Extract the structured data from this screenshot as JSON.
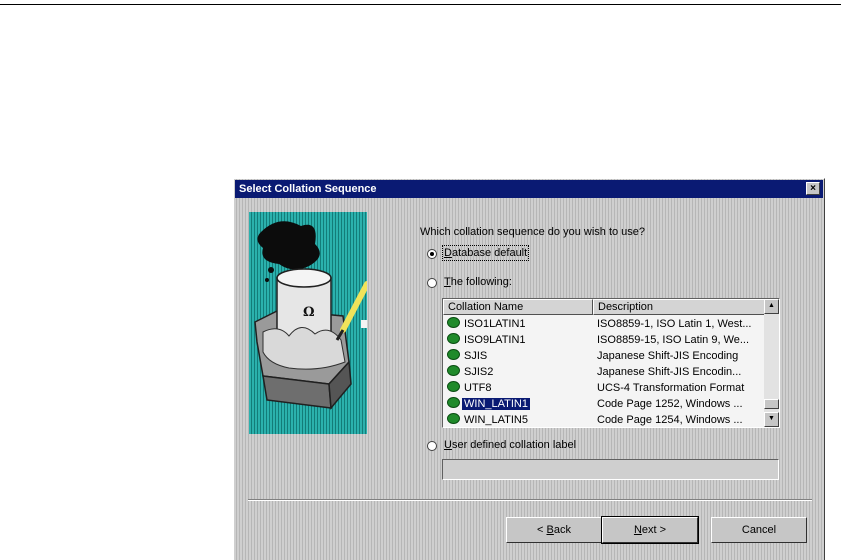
{
  "dialog": {
    "title": "Select Collation Sequence",
    "close_glyph": "×",
    "question": "Which collation sequence do you wish to use?"
  },
  "options": {
    "database_default": {
      "accel": "D",
      "rest": "atabase default",
      "checked": true
    },
    "the_following": {
      "accel": "T",
      "rest": "he following:",
      "checked": false
    },
    "user_defined": {
      "accel": "U",
      "rest": "ser defined collation label",
      "checked": false
    }
  },
  "list": {
    "columns": [
      "Collation Name",
      "Description"
    ],
    "rows": [
      {
        "name": "ISO1LATIN1",
        "description": "ISO8859-1, ISO Latin 1, West..."
      },
      {
        "name": "ISO9LATIN1",
        "description": "ISO8859-15, ISO Latin 9, We..."
      },
      {
        "name": "SJIS",
        "description": "Japanese Shift-JIS Encoding"
      },
      {
        "name": "SJIS2",
        "description": "Japanese Shift-JIS Encodin..."
      },
      {
        "name": "UTF8",
        "description": "UCS-4 Transformation Format"
      },
      {
        "name": "WIN_LATIN1",
        "description": "Code Page 1252, Windows ..."
      },
      {
        "name": "WIN_LATIN5",
        "description": "Code Page 1254, Windows ..."
      }
    ],
    "selected_row": "WIN_LATIN1",
    "scroll_up_glyph": "▲",
    "scroll_down_glyph": "▼"
  },
  "user_label_value": "",
  "buttons": {
    "back": {
      "prefix": "< ",
      "accel": "B",
      "rest": "ack"
    },
    "next": {
      "accel": "N",
      "rest": "ext >"
    },
    "cancel": {
      "label": "Cancel"
    }
  },
  "colors": {
    "titlebar": "#0a1a73",
    "dialog_face": "#c6c6c6",
    "illustration_bg": "#1f9f9c",
    "selection": "#0a1a73",
    "db_icon": "#1f8a2a"
  },
  "icons": {
    "illustration": "database-with-pen-illustration",
    "row_icon": "database-icon"
  }
}
